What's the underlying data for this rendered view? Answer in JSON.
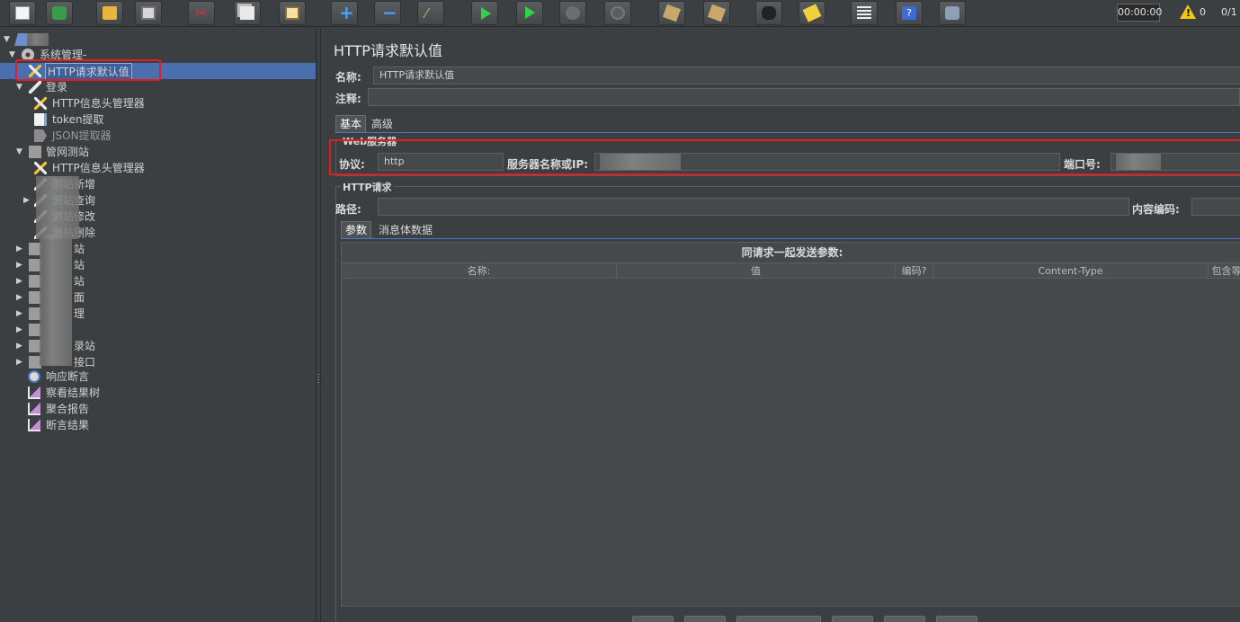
{
  "toolbar": {
    "buttons": [
      {
        "name": "new-icon"
      },
      {
        "name": "templates-icon"
      },
      {
        "name": "open-icon"
      },
      {
        "name": "save-icon"
      },
      {
        "name": "cut-icon"
      },
      {
        "name": "copy-icon"
      },
      {
        "name": "paste-icon"
      },
      {
        "name": "expand-icon"
      },
      {
        "name": "collapse-icon"
      },
      {
        "name": "toggle-icon"
      },
      {
        "name": "start-icon"
      },
      {
        "name": "start-no-pauses-icon"
      },
      {
        "name": "stop-icon"
      },
      {
        "name": "shutdown-icon"
      },
      {
        "name": "clear-icon"
      },
      {
        "name": "clear-all-icon"
      },
      {
        "name": "search-icon"
      },
      {
        "name": "reset-search-icon"
      },
      {
        "name": "function-helper-icon"
      },
      {
        "name": "help-icon"
      },
      {
        "name": "remote-icon"
      }
    ],
    "timer": "00:00:00",
    "warning_count": "0",
    "thread_count": "0/1"
  },
  "tree": {
    "items": [
      {
        "label": "",
        "icon": "test-plan-icon"
      },
      {
        "label": "系统管理-",
        "icon": "gear-icon"
      },
      {
        "label": "HTTP请求默认值",
        "icon": "config-icon"
      },
      {
        "label": "登录",
        "icon": "sampler-icon"
      },
      {
        "label": "HTTP信息头管理器",
        "icon": "config-icon"
      },
      {
        "label": "token提取",
        "icon": "extractor-icon"
      },
      {
        "label": "JSON提取器",
        "icon": "json-icon"
      },
      {
        "label": "管网测站",
        "icon": "folder-icon"
      },
      {
        "label": "HTTP信息头管理器",
        "icon": "config-icon"
      },
      {
        "label": "测站新增",
        "icon": "sampler-icon"
      },
      {
        "label": "测站查询",
        "icon": "sampler-icon"
      },
      {
        "label": "测站修改",
        "icon": "sampler-icon"
      },
      {
        "label": "测站删除",
        "icon": "sampler-icon"
      },
      {
        "label": "站",
        "icon": "folder-icon"
      },
      {
        "label": "站",
        "icon": "folder-icon"
      },
      {
        "label": "站",
        "icon": "folder-icon"
      },
      {
        "label": "面",
        "icon": "folder-icon"
      },
      {
        "label": "理",
        "icon": "folder-icon"
      },
      {
        "label": "",
        "icon": "folder-icon"
      },
      {
        "label": "录站",
        "icon": "folder-icon"
      },
      {
        "label": "接口",
        "icon": "folder-icon"
      },
      {
        "label": "响应断言",
        "icon": "assertion-icon"
      },
      {
        "label": "察看结果树",
        "icon": "listener-icon"
      },
      {
        "label": "聚合报告",
        "icon": "listener-icon"
      },
      {
        "label": "断言结果",
        "icon": "listener-icon"
      }
    ]
  },
  "panel": {
    "title": "HTTP请求默认值",
    "name_label": "名称:",
    "name_value": "HTTP请求默认值",
    "comment_label": "注释:",
    "comment_value": "",
    "tabs": [
      "基本",
      "高级"
    ],
    "web_server": {
      "group_title": "Web服务器",
      "protocol_label": "协议:",
      "protocol_value": "http",
      "server_label": "服务器名称或IP:",
      "server_value": "",
      "port_label": "端口号:",
      "port_value": ""
    },
    "http_request": {
      "group_title": "HTTP请求",
      "path_label": "路径:",
      "path_value": "",
      "encoding_label": "内容编码:",
      "encoding_value": "",
      "tabs": [
        "参数",
        "消息体数据"
      ],
      "table_title": "同请求一起发送参数:",
      "columns": [
        "名称:",
        "值",
        "编码?",
        "Content-Type",
        "包含等"
      ]
    }
  },
  "colors": {
    "background": "#3c3f41",
    "selection": "#4b6eaf",
    "highlight": "#e02020",
    "accent": "#4a78c2"
  }
}
